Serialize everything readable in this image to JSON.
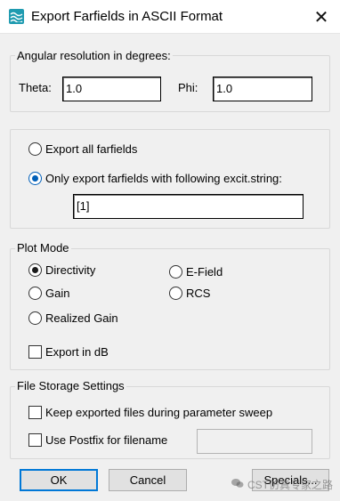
{
  "window": {
    "title": "Export Farfields in ASCII Format",
    "close_glyph": "✕"
  },
  "angular": {
    "legend": "Angular resolution in degrees:",
    "theta_label": "Theta:",
    "theta_value": "1.0",
    "phi_label": "Phi:",
    "phi_value": "1.0"
  },
  "export": {
    "all_label": "Export all farfields",
    "only_label": "Only export farfields with following excit.string:",
    "excit_value": "[1]",
    "selected": "only"
  },
  "plot_mode": {
    "legend": "Plot Mode",
    "options": {
      "directivity": "Directivity",
      "gain": "Gain",
      "realized_gain": "Realized Gain",
      "efield": "E-Field",
      "rcs": "RCS"
    },
    "selected": "directivity",
    "db_label": "Export in dB"
  },
  "file_storage": {
    "legend": "File Storage Settings",
    "keep_label": "Keep exported files during parameter sweep",
    "postfix_label": "Use Postfix for filename",
    "postfix_value": ""
  },
  "buttons": {
    "ok": "OK",
    "cancel": "Cancel",
    "specials": "Specials..."
  },
  "watermark": "CST仿真专家之路",
  "colors": {
    "accent": "#0078d7",
    "radio_selected_blue": "#005fb8",
    "app_icon": "#1f9bb0"
  },
  "icons": {
    "app": "cst-farfield-icon",
    "close": "close-icon",
    "watermark": "wechat-icon"
  }
}
